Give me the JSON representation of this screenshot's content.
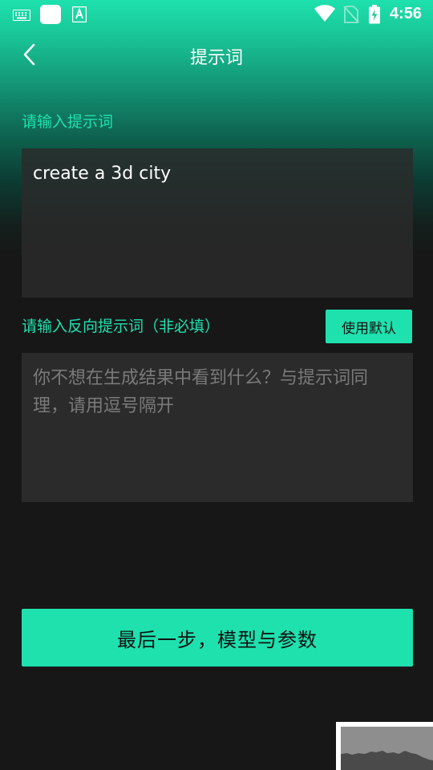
{
  "status_bar": {
    "time": "4:56",
    "icons": [
      "keyboard-icon",
      "app-square-icon",
      "font-a-icon",
      "wifi-icon",
      "no-sim-icon",
      "battery-charging-icon"
    ]
  },
  "header": {
    "title": "提示词",
    "back_icon": "chevron-left-icon"
  },
  "prompt": {
    "label": "请输入提示词",
    "value": "create a 3d city"
  },
  "negative_prompt": {
    "label": "请输入反向提示词（非必填）",
    "placeholder": "你不想在生成结果中看到什么？与提示词同理，请用逗号隔开",
    "value": "",
    "default_button_label": "使用默认"
  },
  "footer": {
    "next_button_label": "最后一步，模型与参数"
  },
  "colors": {
    "accent": "#1ee1ae",
    "background": "#171717",
    "input_background": "#2b2b2b"
  }
}
